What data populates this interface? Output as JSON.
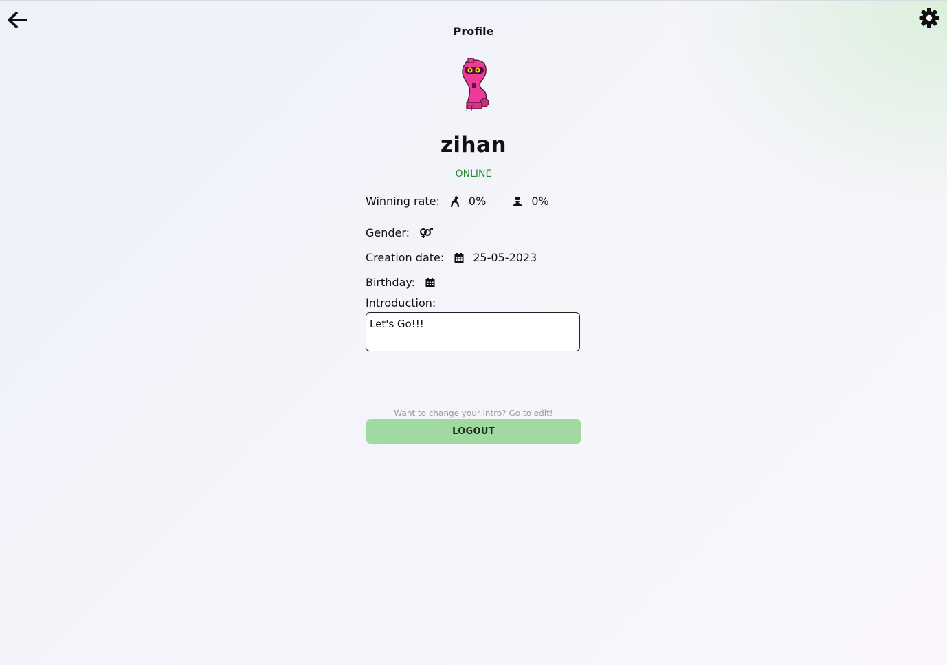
{
  "header": {
    "title": "Profile",
    "back_icon": "arrow-left-icon",
    "settings_icon": "gear-icon"
  },
  "profile": {
    "avatar_icon": "pink-robot-avatar",
    "username": "zihan",
    "status": "ONLINE",
    "status_color": "#1c8a2a",
    "winning_rate_label": "Winning rate:",
    "winning_rate_1": "0%",
    "winning_rate_2": "0%",
    "gender_label": "Gender:",
    "gender_icon": "mars-and-venus-icon",
    "creation_label": "Creation date:",
    "creation_date": "25-05-2023",
    "birthday_label": "Birthday:",
    "intro_label": "Introduction:",
    "intro_text": "Let's Go!!!",
    "hint": "Want to change your intro? Go to edit!",
    "logout_label": "LOGOUT",
    "logout_color": "#a1daa1"
  }
}
